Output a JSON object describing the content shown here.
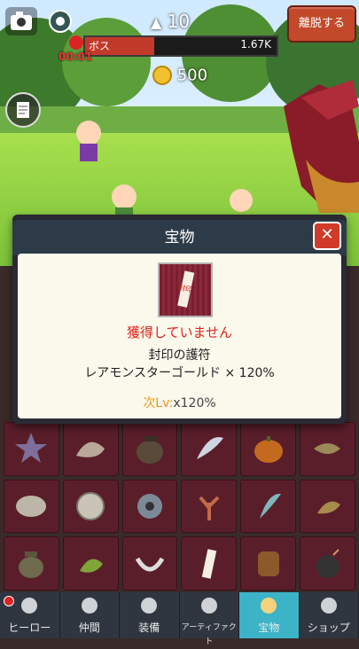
{
  "hud": {
    "stage_level": "10",
    "leave_button": "離脱する",
    "boss_label": "ボス",
    "boss_hp": "1.67K",
    "timer": "00:01",
    "gold": "500"
  },
  "dialog": {
    "title": "宝物",
    "close_glyph": "✕",
    "item_icon_text": "封印",
    "status": "獲得していません",
    "item_name": "封印の護符",
    "effect": "レアモンスターゴールド × 120%",
    "next_label": "次Lv:",
    "next_value": "x120%"
  },
  "treasures": [
    "star-fish-icon",
    "shell-icon",
    "pot-icon",
    "feather-icon",
    "pumpkin-icon",
    "fish-icon",
    "fossil-icon",
    "coin-icon",
    "gear-icon",
    "coral-icon",
    "tooth-icon",
    "leaf-icon",
    "vase-icon",
    "leaf-cluster-icon",
    "necklace-icon",
    "seal-charm-icon",
    "barrel-icon",
    "bomb-icon"
  ],
  "tabs": [
    {
      "label": "ヒーロー",
      "icon": "hero-icon"
    },
    {
      "label": "仲間",
      "icon": "companions-icon"
    },
    {
      "label": "装備",
      "icon": "equipment-icon"
    },
    {
      "label": "アーティファクト",
      "icon": "artifact-icon"
    },
    {
      "label": "宝物",
      "icon": "treasure-icon"
    },
    {
      "label": "ショップ",
      "icon": "shop-icon"
    }
  ],
  "colors": {
    "accent": "#3cb3c7",
    "danger": "#e0231a",
    "panel": "#fbf8ec"
  }
}
